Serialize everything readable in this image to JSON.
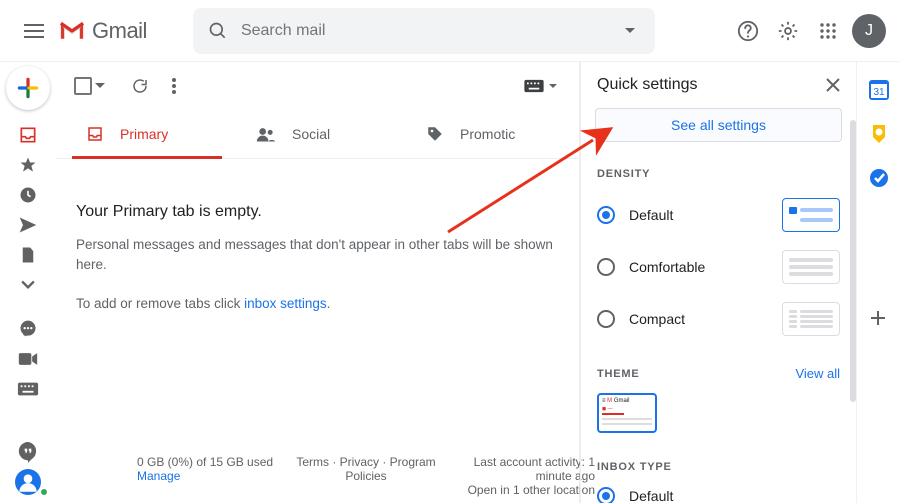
{
  "header": {
    "app_name": "Gmail",
    "search_placeholder": "Search mail",
    "avatar_initial": "J"
  },
  "tabs": {
    "primary": "Primary",
    "social": "Social",
    "promotions": "Promotic"
  },
  "empty_state": {
    "title": "Your Primary tab is empty.",
    "line1": "Personal messages and messages that don't appear in other tabs will be shown here.",
    "line2_a": "To add or remove tabs click ",
    "line2_link": "inbox settings",
    "line2_b": "."
  },
  "footer": {
    "storage_a": "0 GB (0%) of 15 GB used",
    "storage_b": "Manage",
    "policies": "Terms · Privacy · Program Policies",
    "activity_a": "Last account activity: 1 minute ago",
    "activity_b": "Open in 1 other location"
  },
  "quick_settings": {
    "title": "Quick settings",
    "see_all": "See all settings",
    "density_label": "DENSITY",
    "density_opts": {
      "0": "Default",
      "1": "Comfortable",
      "2": "Compact"
    },
    "theme_label": "THEME",
    "view_all": "View all",
    "inbox_type_label": "INBOX TYPE",
    "inbox_type_opts": {
      "0": "Default"
    }
  },
  "sidepanel": {
    "calendar_day": "31"
  }
}
